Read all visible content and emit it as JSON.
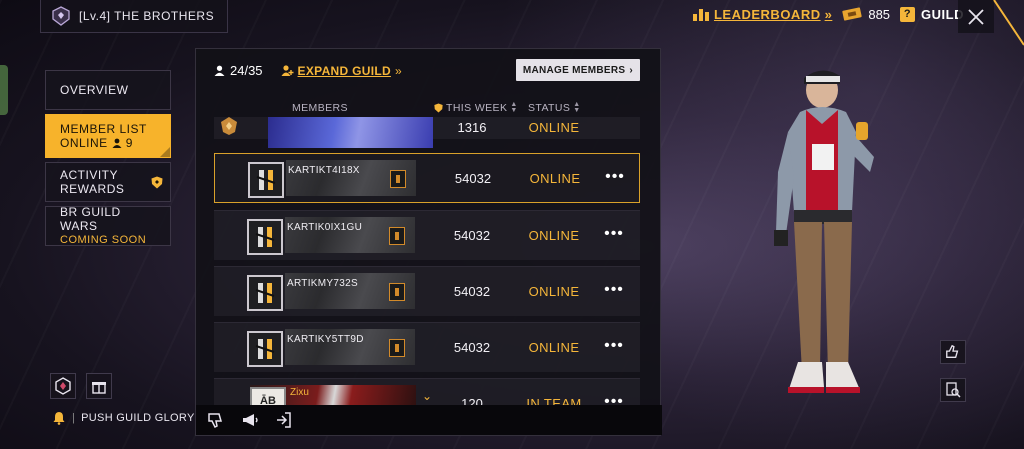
{
  "guild": {
    "title": "[Lv.4] THE BROTHERS"
  },
  "topbar": {
    "leaderboard_label": "LEADERBOARD",
    "currency_amount": "885",
    "guild_label": "GUILD"
  },
  "nav": {
    "overview": "OVERVIEW",
    "member_list": "MEMBER LIST",
    "online_label": "ONLINE",
    "online_count": "9",
    "activity_line1": "ACTIVITY",
    "activity_line2": "REWARDS",
    "br_wars": "BR GUILD WARS",
    "coming_soon": "COMING SOON"
  },
  "bottom_left": {
    "push_label": "PUSH GUILD GLORY"
  },
  "panel": {
    "member_count": "24/35",
    "expand_label": "EXPAND GUILD",
    "manage_label": "MANAGE MEMBERS",
    "col_members": "MEMBERS",
    "col_week": "THIS WEEK",
    "col_status": "STATUS"
  },
  "rows": [
    {
      "name": "",
      "score": "1316",
      "status": "ONLINE"
    },
    {
      "name": "KARTIKT4I18X",
      "score": "54032",
      "status": "ONLINE"
    },
    {
      "name": "KARTIK0IX1GU",
      "score": "54032",
      "status": "ONLINE"
    },
    {
      "name": "ARTIKMY732S",
      "score": "54032",
      "status": "ONLINE"
    },
    {
      "name": "KARTIKY5TT9D",
      "score": "54032",
      "status": "ONLINE"
    },
    {
      "name": "Zixu",
      "score": "120",
      "status": "IN TEAM"
    }
  ],
  "colors": {
    "accent": "#f5b63a",
    "active_tab": "#f7b32b",
    "panel_bg": "#121117"
  },
  "icons": [
    "guild-emblem-icon",
    "leaderboard-icon",
    "currency-ticket-icon",
    "question-icon",
    "close-icon",
    "member-icon",
    "expand-guild-icon",
    "chevron-right-icon",
    "shield-icon",
    "guild-badge-icon",
    "gift-icon",
    "bell-icon",
    "thumbs-down-icon",
    "megaphone-icon",
    "exit-icon",
    "more-icon",
    "thumbs-up-icon",
    "search-doc-icon"
  ]
}
